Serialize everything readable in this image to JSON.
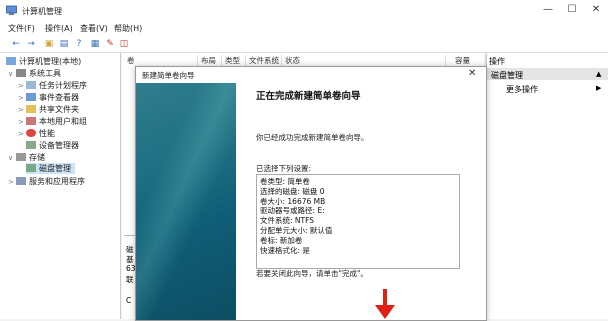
{
  "window": {
    "title": "计算机管理",
    "controls": [
      "—",
      "☐",
      "✕"
    ]
  },
  "menu": [
    "文件(F)",
    "操作(A)",
    "查看(V)",
    "帮助(H)"
  ],
  "toolbar": {
    "icons": [
      "back-icon",
      "forward-icon",
      "up-icon",
      "view-icon",
      "help-icon",
      "properties-icon",
      "export-icon"
    ]
  },
  "tree": {
    "root": "计算机管理(本地)",
    "items": [
      {
        "label": "系统工具",
        "level": 1,
        "expanded": true
      },
      {
        "label": "任务计划程序",
        "level": 2
      },
      {
        "label": "事件查看器",
        "level": 2
      },
      {
        "label": "共享文件夹",
        "level": 2
      },
      {
        "label": "本地用户和组",
        "level": 2
      },
      {
        "label": "性能",
        "level": 2
      },
      {
        "label": "设备管理器",
        "level": 2
      },
      {
        "label": "存储",
        "level": 1,
        "expanded": true
      },
      {
        "label": "磁盘管理",
        "level": 2,
        "selected": true
      },
      {
        "label": "服务和应用程序",
        "level": 1
      }
    ]
  },
  "list": {
    "columns": [
      "卷",
      "布局",
      "类型",
      "文件系统",
      "状态",
      "容量"
    ],
    "partial_texts": [
      "磁",
      "基",
      "63",
      "联",
      "C"
    ]
  },
  "actions": {
    "header": "操作",
    "section": "磁盘管理",
    "more": "更多操作"
  },
  "wizard": {
    "title": "新建简单卷向导",
    "heading": "正在完成新建简单卷向导",
    "intro": "你已经成功完成新建简单卷向导。",
    "settings_label": "已选择下列设置:",
    "settings": [
      "卷类型: 简单卷",
      "选择的磁盘: 磁盘 0",
      "卷大小: 16676 MB",
      "驱动器号或路径: E:",
      "文件系统: NTFS",
      "分配单元大小: 默认值",
      "卷标: 新加卷",
      "快速格式化: 是"
    ],
    "close_hint": "若要关闭此向导，请单击\"完成\"。"
  }
}
